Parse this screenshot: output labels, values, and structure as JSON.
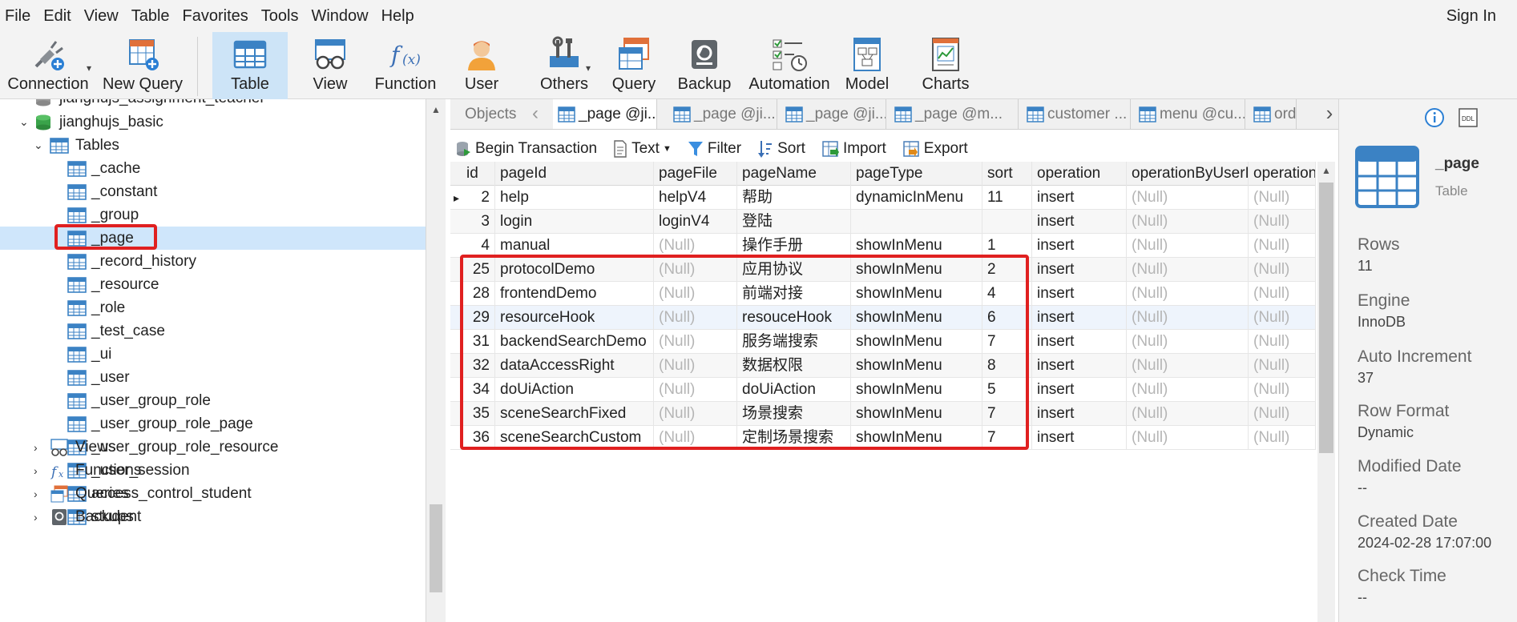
{
  "menu": [
    "File",
    "Edit",
    "View",
    "Table",
    "Favorites",
    "Tools",
    "Window",
    "Help"
  ],
  "sign_in": "Sign In",
  "toolbar": [
    {
      "label": "Connection",
      "icon": "connection-icon"
    },
    {
      "label": "New Query",
      "icon": "new-query-icon"
    },
    {
      "label": "Table",
      "icon": "table-icon",
      "active": true
    },
    {
      "label": "View",
      "icon": "view-icon"
    },
    {
      "label": "Function",
      "icon": "function-icon"
    },
    {
      "label": "User",
      "icon": "user-icon"
    },
    {
      "label": "Others",
      "icon": "others-icon"
    },
    {
      "label": "Query",
      "icon": "query-icon"
    },
    {
      "label": "Backup",
      "icon": "backup-icon"
    },
    {
      "label": "Automation",
      "icon": "automation-icon"
    },
    {
      "label": "Model",
      "icon": "model-icon"
    },
    {
      "label": "Charts",
      "icon": "charts-icon"
    }
  ],
  "tree": {
    "partial_item": "jianghujs_assignment_teacher",
    "database": "jianghujs_basic",
    "tables_label": "Tables",
    "tables": [
      "_cache",
      "_constant",
      "_group",
      "_page",
      "_record_history",
      "_resource",
      "_role",
      "_test_case",
      "_ui",
      "_user",
      "_user_group_role",
      "_user_group_role_page",
      "_user_group_role_resource",
      "_user_session",
      "access_control_student",
      "student"
    ],
    "selected_table": "_page",
    "groups": [
      "Views",
      "Functions",
      "Queries",
      "Backups"
    ]
  },
  "tabs": [
    "Objects",
    "_page @ji...",
    "_page @ji...",
    "_page @ji...",
    "_page @m...",
    "customer ...",
    "menu @cu...",
    "orde"
  ],
  "data_toolbar": {
    "begin": "Begin Transaction",
    "text": "Text",
    "filter": "Filter",
    "sort": "Sort",
    "import": "Import",
    "export": "Export"
  },
  "grid": {
    "columns": [
      "id",
      "pageId",
      "pageFile",
      "pageName",
      "pageType",
      "sort",
      "operation",
      "operationByUserI",
      "operation"
    ],
    "rows": [
      [
        "2",
        "help",
        "helpV4",
        "帮助",
        "dynamicInMenu",
        "11",
        "insert",
        "(Null)",
        "(Null)"
      ],
      [
        "3",
        "login",
        "loginV4",
        "登陆",
        "",
        "",
        "insert",
        "(Null)",
        "(Null)"
      ],
      [
        "4",
        "manual",
        "(Null)",
        "操作手册",
        "showInMenu",
        "1",
        "insert",
        "(Null)",
        "(Null)"
      ],
      [
        "25",
        "protocolDemo",
        "(Null)",
        "应用协议",
        "showInMenu",
        "2",
        "insert",
        "(Null)",
        "(Null)"
      ],
      [
        "28",
        "frontendDemo",
        "(Null)",
        "前端对接",
        "showInMenu",
        "4",
        "insert",
        "(Null)",
        "(Null)"
      ],
      [
        "29",
        "resourceHook",
        "(Null)",
        "resouceHook",
        "showInMenu",
        "6",
        "insert",
        "(Null)",
        "(Null)"
      ],
      [
        "31",
        "backendSearchDemo",
        "(Null)",
        "服务端搜索",
        "showInMenu",
        "7",
        "insert",
        "(Null)",
        "(Null)"
      ],
      [
        "32",
        "dataAccessRight",
        "(Null)",
        "数据权限",
        "showInMenu",
        "8",
        "insert",
        "(Null)",
        "(Null)"
      ],
      [
        "34",
        "doUiAction",
        "(Null)",
        "doUiAction",
        "showInMenu",
        "5",
        "insert",
        "(Null)",
        "(Null)"
      ],
      [
        "35",
        "sceneSearchFixed",
        "(Null)",
        "场景搜索",
        "showInMenu",
        "7",
        "insert",
        "(Null)",
        "(Null)"
      ],
      [
        "36",
        "sceneSearchCustom",
        "(Null)",
        "定制场景搜索",
        "showInMenu",
        "7",
        "insert",
        "(Null)",
        "(Null)"
      ]
    ]
  },
  "info": {
    "name": "_page",
    "type": "Table",
    "rows_label": "Rows",
    "rows_value": "11",
    "engine_label": "Engine",
    "engine_value": "InnoDB",
    "auto_inc_label": "Auto Increment",
    "auto_inc_value": "37",
    "row_format_label": "Row Format",
    "row_format_value": "Dynamic",
    "modified_label": "Modified Date",
    "modified_value": "--",
    "created_label": "Created Date",
    "created_value": "2024-02-28 17:07:00",
    "check_label": "Check Time",
    "check_value": "--"
  },
  "colors": {
    "accent": "#2b7fd4",
    "highlight": "#e02020",
    "selected": "#cfe6fb",
    "toolbar_active": "#cde4f7"
  }
}
